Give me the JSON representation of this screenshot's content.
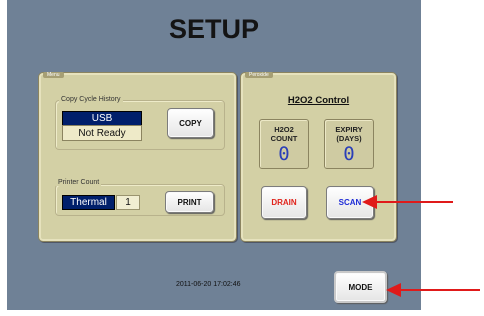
{
  "title": "SETUP",
  "menu_panel": {
    "tab_label": "Menu",
    "copy_history": {
      "label": "Copy Cycle History",
      "device": "USB",
      "status": "Not Ready",
      "copy_button": "COPY"
    },
    "printer": {
      "label": "Printer Count",
      "printer_type": "Thermal",
      "count": "1",
      "print_button": "PRINT"
    }
  },
  "peroxide_panel": {
    "tab_label": "Peroxide",
    "title": "H2O2 Control",
    "h2o2_count": {
      "label_line1": "H2O2",
      "label_line2": "COUNT",
      "value": "0"
    },
    "expiry": {
      "label_line1": "EXPIRY",
      "label_line2": "(DAYS)",
      "value": "0"
    },
    "drain_button": "DRAIN",
    "scan_button": "SCAN"
  },
  "footer": {
    "datetime": "2011-06-20  17:02:46",
    "mode_button": "MODE"
  },
  "colors": {
    "screen_bg": "#6f8196",
    "panel_bg": "#d3d0a5",
    "drain_text": "#e0231b",
    "scan_text": "#1d2bd6",
    "value_text": "#2b3fb8",
    "arrow": "#e01a1a",
    "badge_bg": "#001f6b"
  },
  "icons": [
    "arrow-left-icon"
  ]
}
